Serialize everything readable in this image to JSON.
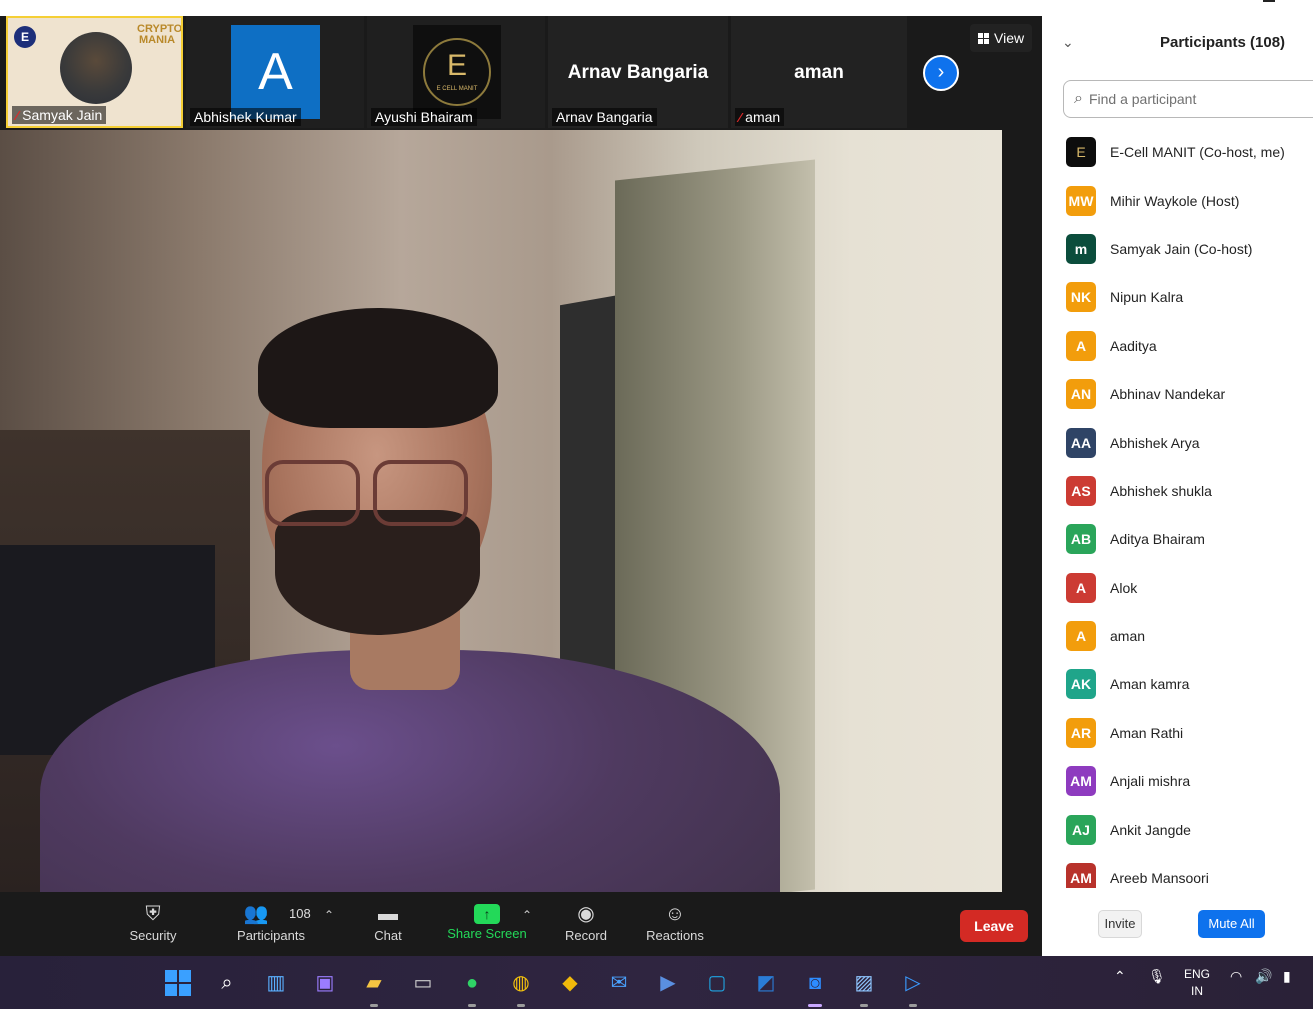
{
  "thumbnails": [
    {
      "name": "Samyak Jain",
      "muted": true,
      "emblem_text": "E",
      "banner_text": "CRYPTO MANIA"
    },
    {
      "name": "Abhishek Kumar",
      "muted": false,
      "avatar_letter": "A"
    },
    {
      "name": "Ayushi Bhairam",
      "muted": false,
      "logo_letter": "E",
      "logo_sub": "E CELL MANIT"
    },
    {
      "name": "Arnav Bangaria",
      "muted": false,
      "display_name": "Arnav Bangaria"
    },
    {
      "name": "aman",
      "muted": true,
      "display_name": "aman"
    }
  ],
  "view_label": "View",
  "toolbar": {
    "security": "Security",
    "participants": "Participants",
    "participants_count": "108",
    "chat": "Chat",
    "share_screen": "Share Screen",
    "record": "Record",
    "reactions": "Reactions",
    "leave": "Leave"
  },
  "panel": {
    "title": "Participants (108)",
    "search_placeholder": "Find a participant",
    "participants": [
      {
        "initials": "E",
        "name": "E-Cell MANIT (Co-host, me)",
        "color": "#0d0d0d"
      },
      {
        "initials": "MW",
        "name": "Mihir Waykole (Host)",
        "color": "#f29d0c"
      },
      {
        "initials": "m",
        "name": "Samyak Jain (Co-host)",
        "color": "#0b4d3c"
      },
      {
        "initials": "NK",
        "name": "Nipun Kalra",
        "color": "#f29d0c"
      },
      {
        "initials": "A",
        "name": "Aaditya",
        "color": "#f29d0c"
      },
      {
        "initials": "AN",
        "name": "Abhinav Nandekar",
        "color": "#f29d0c"
      },
      {
        "initials": "AA",
        "name": "Abhishek Arya",
        "color": "#2f4466"
      },
      {
        "initials": "AS",
        "name": "Abhishek shukla",
        "color": "#cc3b33"
      },
      {
        "initials": "AB",
        "name": "Aditya Bhairam",
        "color": "#2aa55a"
      },
      {
        "initials": "A",
        "name": "Alok",
        "color": "#cc3b33"
      },
      {
        "initials": "A",
        "name": "aman",
        "color": "#f29d0c"
      },
      {
        "initials": "AK",
        "name": "Aman kamra",
        "color": "#1fa58a"
      },
      {
        "initials": "AR",
        "name": "Aman Rathi",
        "color": "#f29d0c"
      },
      {
        "initials": "AM",
        "name": "Anjali mishra",
        "color": "#8e3bbf"
      },
      {
        "initials": "AJ",
        "name": "Ankit Jangde",
        "color": "#2aa55a"
      },
      {
        "initials": "AM",
        "name": "Areeb Mansoori",
        "color": "#b8322b"
      }
    ],
    "invite": "Invite",
    "mute_all": "Mute All"
  },
  "taskbar": {
    "lang_top": "ENG",
    "lang_bottom": "IN"
  },
  "icons": {
    "mic_muted": "mic-muted-icon",
    "next": "chevron-right-icon",
    "security": "shield-icon",
    "participants": "people-icon",
    "chat": "chat-bubble-icon",
    "share": "share-screen-icon",
    "record": "record-icon",
    "reactions": "reaction-icon",
    "search": "search-icon"
  },
  "colors": {
    "zoom_blue": "#0e72ed",
    "leave_red": "#d32a24",
    "share_green": "#23d959"
  }
}
